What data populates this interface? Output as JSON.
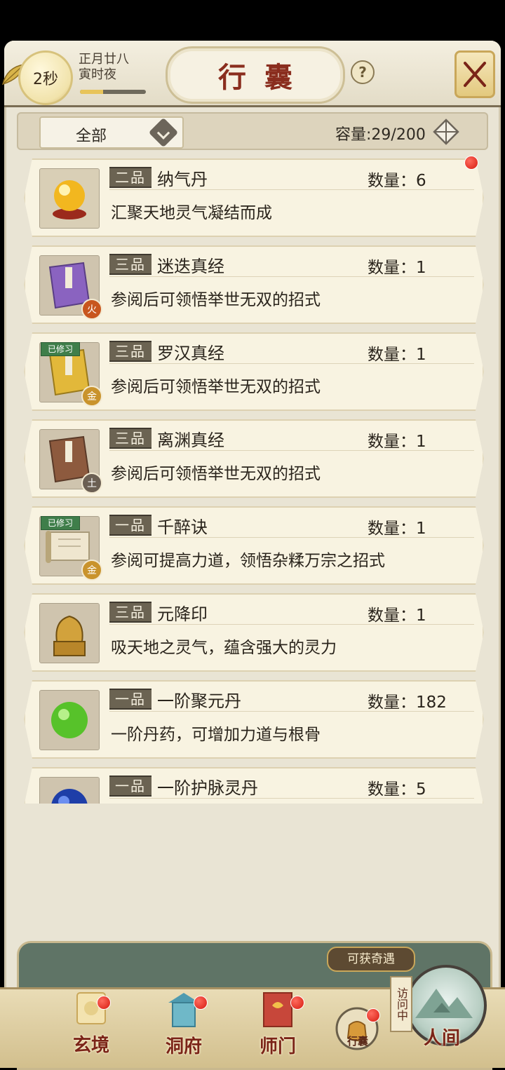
{
  "header": {
    "timer": "2秒",
    "date_line1": "正月廿八",
    "date_line2": "寅时夜",
    "time_progress": 0.35,
    "title": "行囊",
    "help_glyph": "?"
  },
  "filter": {
    "selected": "全部",
    "capacity": "容量:29/200"
  },
  "items": [
    {
      "grade": "二品",
      "name": "纳气丹",
      "qty": "数量：6",
      "desc": "汇聚天地灵气凝结而成",
      "icon": "golden-orb-icon",
      "new": true
    },
    {
      "grade": "三品",
      "name": "迷迭真经",
      "qty": "数量：1",
      "desc": "参阅后可领悟举世无双的招式",
      "icon": "purple-book-icon",
      "element": "火"
    },
    {
      "grade": "三品",
      "name": "罗汉真经",
      "qty": "数量：1",
      "desc": "参阅后可领悟举世无双的招式",
      "icon": "yellow-book-icon",
      "element": "金",
      "learned": "已修习"
    },
    {
      "grade": "三品",
      "name": "离渊真经",
      "qty": "数量：1",
      "desc": "参阅后可领悟举世无双的招式",
      "icon": "brown-book-icon",
      "element": "土"
    },
    {
      "grade": "一品",
      "name": "千醉诀",
      "qty": "数量：1",
      "desc": "参阅可提高力道，领悟杂糅万宗之招式",
      "icon": "scroll-icon",
      "element": "金",
      "learned": "已修习"
    },
    {
      "grade": "三品",
      "name": "元降印",
      "qty": "数量：1",
      "desc": "吸天地之灵气，蕴含强大的灵力",
      "icon": "dragon-seal-icon"
    },
    {
      "grade": "一品",
      "name": "一阶聚元丹",
      "qty": "数量：182",
      "desc": "一阶丹药，可增加力道与根骨",
      "icon": "green-pill-icon"
    },
    {
      "grade": "一品",
      "name": "一阶护脉灵丹",
      "qty": "数量：5",
      "desc": "",
      "icon": "blue-pill-icon"
    }
  ],
  "nav": {
    "xuanjing": "玄境",
    "dongfu": "洞府",
    "shimen": "师门",
    "xingnang": "行囊",
    "renjian": "人间",
    "encounter": "可获奇遇",
    "visiting": "访问中"
  },
  "colors": {
    "grade_bg": "#6b6352",
    "title_red": "#8a2d1e",
    "learned_green": "#3f7e4a",
    "notice_red": "#d61b10",
    "fire": "#c8561e",
    "metal": "#c9932c",
    "earth": "#6b5f53"
  }
}
